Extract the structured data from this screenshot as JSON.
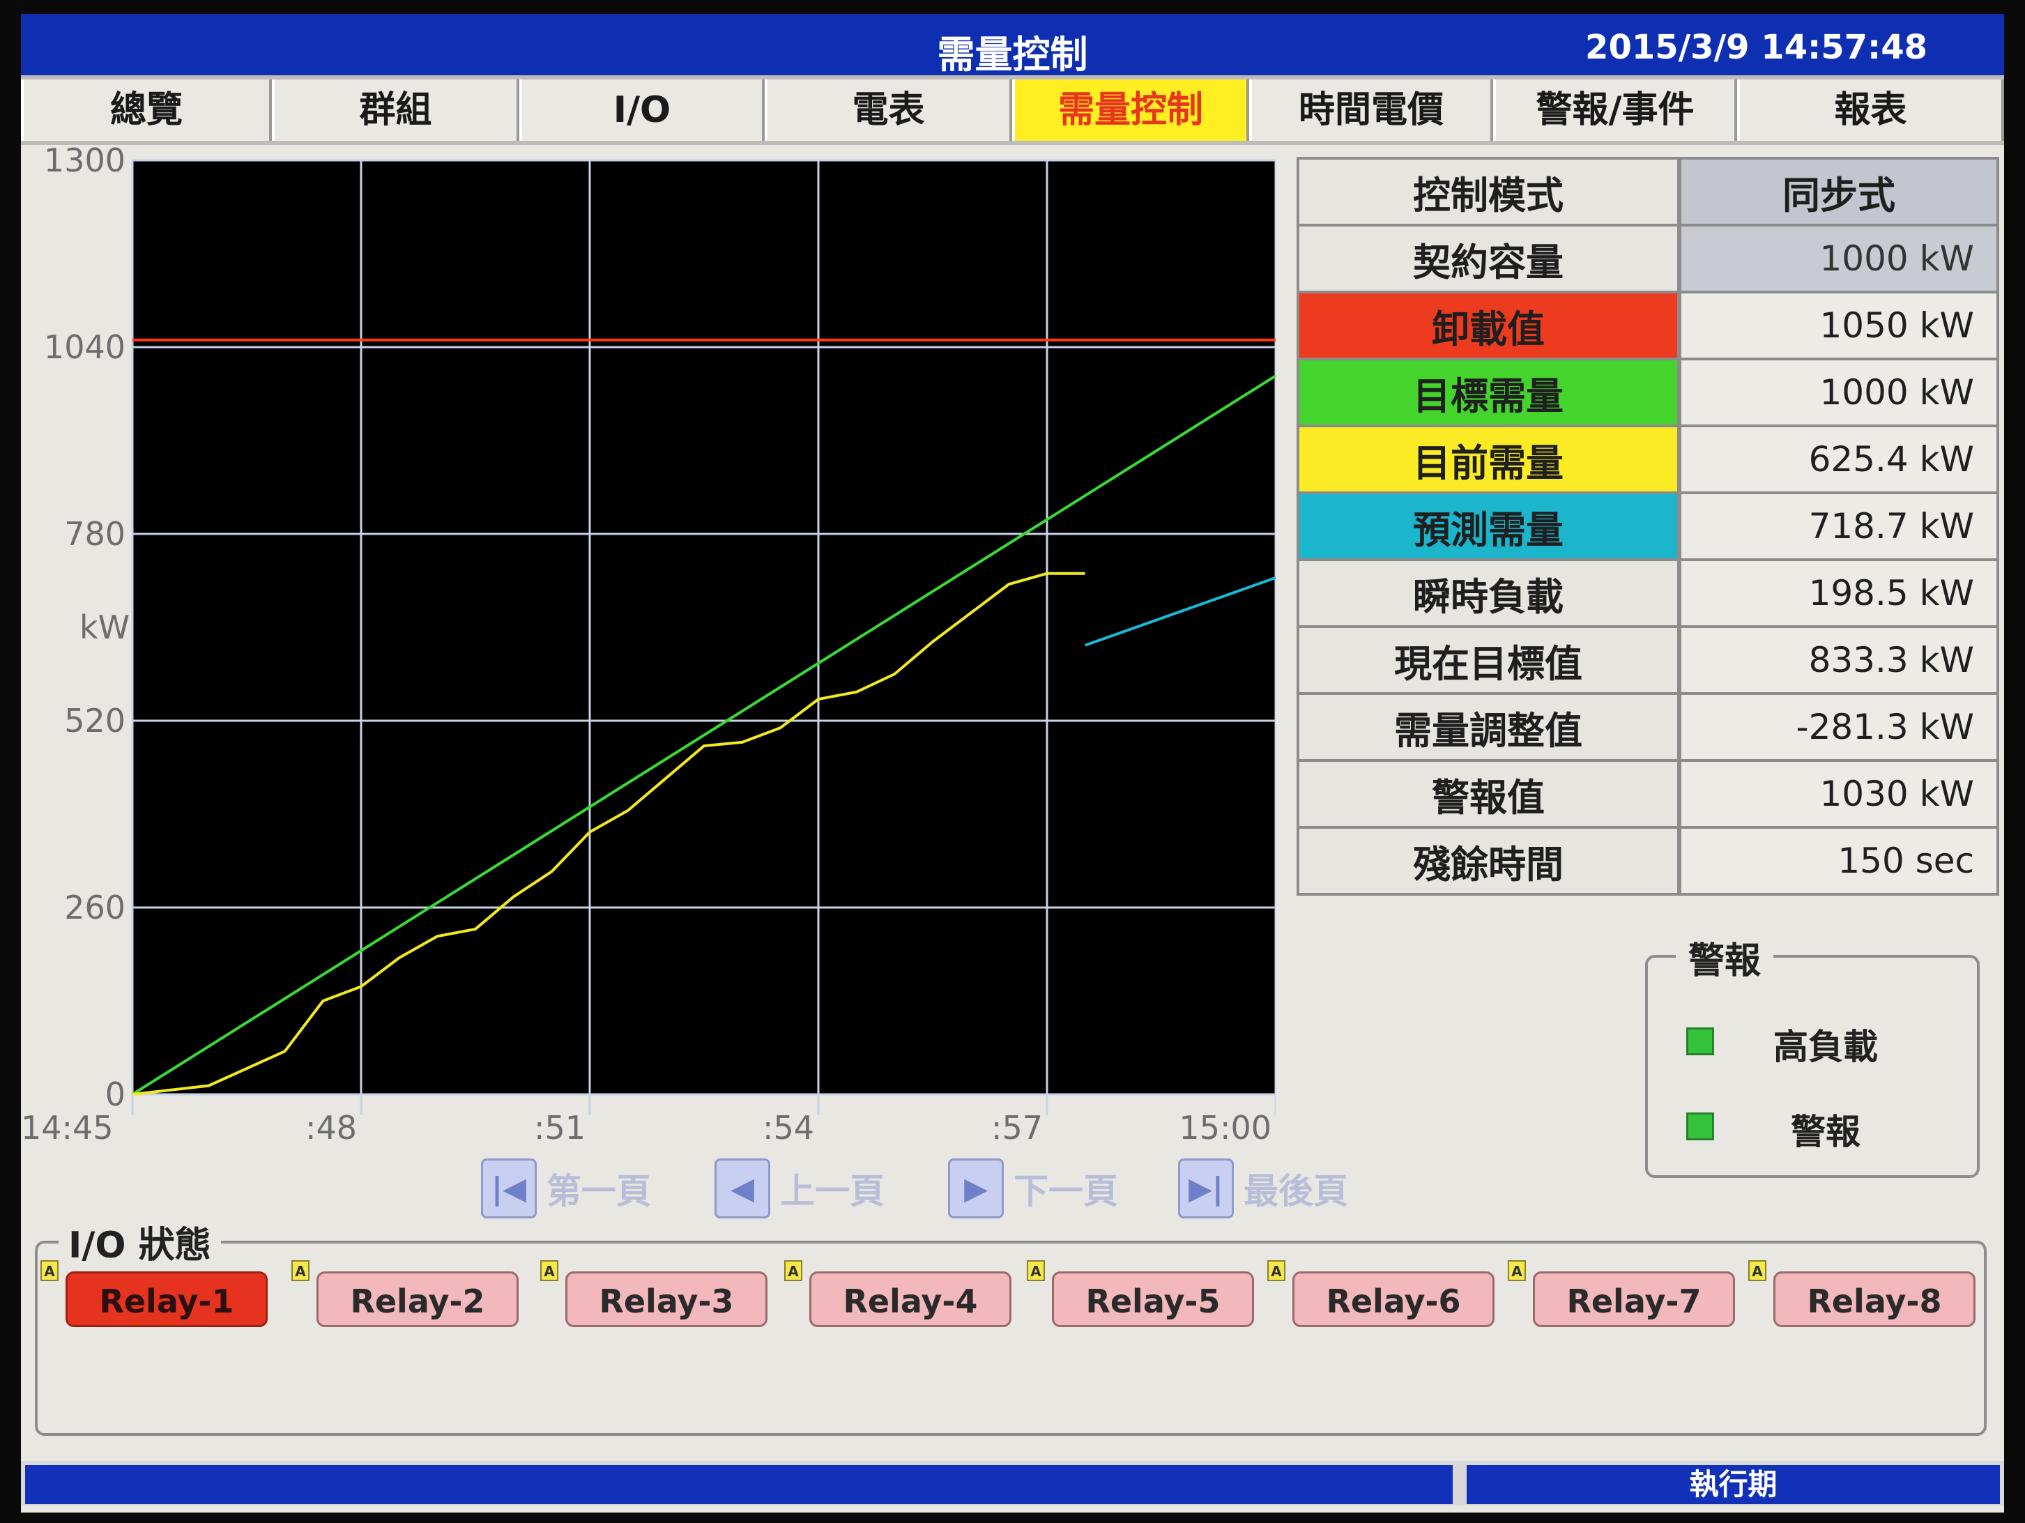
{
  "window": {
    "title": "需量控制",
    "datetime": "2015/3/9 14:57:48"
  },
  "tabs": [
    {
      "label": "總覽",
      "active": false
    },
    {
      "label": "群組",
      "active": false
    },
    {
      "label": "I/O",
      "active": false
    },
    {
      "label": "電表",
      "active": false
    },
    {
      "label": "需量控制",
      "active": true
    },
    {
      "label": "時間電價",
      "active": false
    },
    {
      "label": "警報/事件",
      "active": false
    },
    {
      "label": "報表",
      "active": false
    }
  ],
  "chart_data": {
    "type": "line",
    "ylabel": "kW",
    "ylim": [
      0,
      1300
    ],
    "y_ticks": [
      "0",
      "260",
      "520",
      "780",
      "1040",
      "1300"
    ],
    "x_ticks": [
      "14:45",
      ":48",
      ":51",
      ":54",
      ":57",
      "15:00"
    ],
    "xlim": [
      0,
      15
    ],
    "grid": true,
    "colors": {
      "background": "#000000",
      "grid": "#c9d3e8",
      "red": "#ff3a1a",
      "green": "#3bd936",
      "yellow": "#f3e91e",
      "cyan": "#19b9d8"
    },
    "series": [
      {
        "color": "red",
        "x": [
          0,
          15
        ],
        "y": [
          1050,
          1050
        ]
      },
      {
        "color": "green",
        "x": [
          0,
          15
        ],
        "y": [
          0,
          1000
        ]
      },
      {
        "color": "yellow",
        "x": [
          0,
          1,
          2,
          2.5,
          3,
          3.5,
          4,
          4.5,
          5,
          5.5,
          6,
          6.5,
          7,
          7.5,
          8,
          8.5,
          9,
          9.5,
          10,
          10.5,
          11,
          11.5,
          12,
          12.5
        ],
        "y": [
          0,
          12,
          60,
          130,
          150,
          190,
          220,
          230,
          275,
          310,
          365,
          395,
          440,
          485,
          490,
          510,
          550,
          560,
          585,
          630,
          670,
          710,
          725,
          725
        ]
      },
      {
        "color": "cyan",
        "x": [
          12.5,
          15
        ],
        "y": [
          625,
          719
        ]
      }
    ]
  },
  "pager": {
    "first": "第一頁",
    "prev": "上一頁",
    "next": "下一頁",
    "last": "最後頁"
  },
  "info_table": [
    {
      "label": "控制模式",
      "value": "同步式"
    },
    {
      "label": "契約容量",
      "value": "1000 kW"
    },
    {
      "label": "卸載值",
      "value": "1050 kW",
      "color": "#ec3b1f"
    },
    {
      "label": "目標需量",
      "value": "1000 kW",
      "color": "#44d42c"
    },
    {
      "label": "目前需量",
      "value": "625.4 kW",
      "color": "#fbeb25"
    },
    {
      "label": "預測需量",
      "value": "718.7 kW",
      "color": "#1bb5cc"
    },
    {
      "label": "瞬時負載",
      "value": "198.5 kW"
    },
    {
      "label": "現在目標值",
      "value": "833.3 kW"
    },
    {
      "label": "需量調整值",
      "value": "-281.3 kW"
    },
    {
      "label": "警報值",
      "value": "1030 kW"
    },
    {
      "label": "殘餘時間",
      "value": "150 sec"
    }
  ],
  "alarm": {
    "title": "警報",
    "items": [
      {
        "label": "高負載"
      },
      {
        "label": "警報"
      }
    ]
  },
  "io_status": {
    "title": "I/O 狀態",
    "relays": [
      {
        "label": "Relay-1",
        "on": true
      },
      {
        "label": "Relay-2",
        "on": false
      },
      {
        "label": "Relay-3",
        "on": false
      },
      {
        "label": "Relay-4",
        "on": false
      },
      {
        "label": "Relay-5",
        "on": false
      },
      {
        "label": "Relay-6",
        "on": false
      },
      {
        "label": "Relay-7",
        "on": false
      },
      {
        "label": "Relay-8",
        "on": false
      }
    ],
    "auto_badge": "A"
  },
  "status_bar": {
    "right": "執行期"
  }
}
